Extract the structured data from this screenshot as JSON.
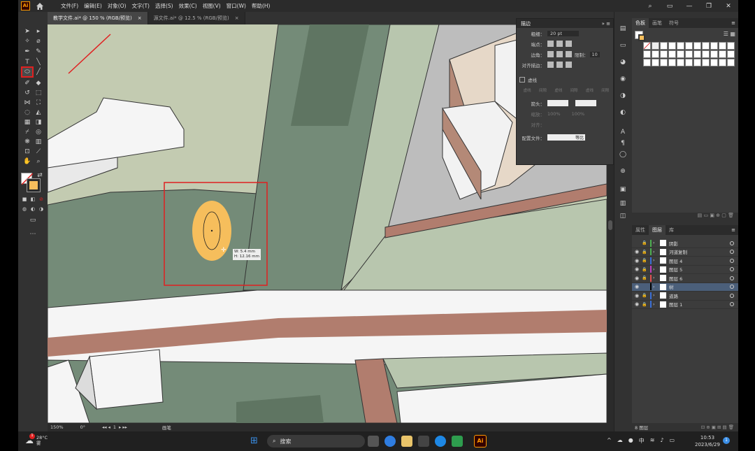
{
  "menubar": {
    "logo": "Ai",
    "menus": [
      "文件(F)",
      "编辑(E)",
      "对象(O)",
      "文字(T)",
      "选择(S)",
      "效果(C)",
      "视图(V)",
      "窗口(W)",
      "帮助(H)"
    ]
  },
  "tabs": [
    {
      "label": "教学文件.ai* @ 150 % (RGB/预览)",
      "close": "×"
    },
    {
      "label": "源文件.ai* @ 12.5 % (RGB/预览)",
      "close": "×"
    }
  ],
  "stroke_panel": {
    "title": "描边",
    "weight_label": "粗细：",
    "weight_value": "20 pt",
    "cap_label": "端点：",
    "corner_label": "边角：",
    "limit_label": "限制：",
    "limit_value": "10",
    "align_label": "对齐描边：",
    "dashed_label": "虚线",
    "dash_cols": [
      "虚线",
      "间隙",
      "虚线",
      "间隙",
      "虚线",
      "间隙"
    ],
    "arrows_label": "箭头：",
    "scale_label": "缩放：",
    "scale_values": [
      "100%",
      "100%"
    ],
    "align2_label": "对齐：",
    "profile_label": "配置文件：",
    "profile_value": "等比"
  },
  "swatch_panel": {
    "tabs": [
      "色板",
      "画笔",
      "符号"
    ]
  },
  "layers_panel": {
    "tabs": [
      "属性",
      "图层",
      "库"
    ],
    "layers": [
      {
        "name": "阴影",
        "color": "#4caf50",
        "locked": true,
        "visible": false
      },
      {
        "name": "河道复制",
        "color": "#4caf50",
        "locked": true,
        "visible": true
      },
      {
        "name": "图层 4",
        "color": "#3b6fd6",
        "locked": true,
        "visible": true
      },
      {
        "name": "图层 5",
        "color": "#c040c0",
        "locked": true,
        "visible": true
      },
      {
        "name": "图层 6",
        "color": "#e05050",
        "locked": true,
        "visible": true
      },
      {
        "name": "树",
        "color": "#000000",
        "locked": false,
        "visible": true,
        "selected": true
      },
      {
        "name": "道路",
        "color": "#3b6fd6",
        "locked": true,
        "visible": true
      },
      {
        "name": "图层 1",
        "color": "#3b6fd6",
        "locked": true,
        "visible": true
      }
    ],
    "footer": "8 图层"
  },
  "canvas": {
    "tooltip_w": "W: 5.4 mm",
    "tooltip_h": "H: 12.16 mm"
  },
  "statusbar": {
    "zoom": "150%",
    "angle": "0°",
    "artboard": "1",
    "mode": "画笔"
  },
  "taskbar": {
    "weather_temp": "28°C",
    "weather_desc": "雾",
    "search_placeholder": "搜索",
    "ime": "中",
    "time": "10:53",
    "date": "2023/6/29",
    "badge": "1",
    "weather_badge": "1"
  },
  "colors": {
    "accent": "#ff9a00",
    "tree_fill": "#f6be5c",
    "grass_dark": "#748b78",
    "grass_light": "#c3cbb1",
    "road_brown": "#b17d6e",
    "highlight_red": "#e02020"
  }
}
